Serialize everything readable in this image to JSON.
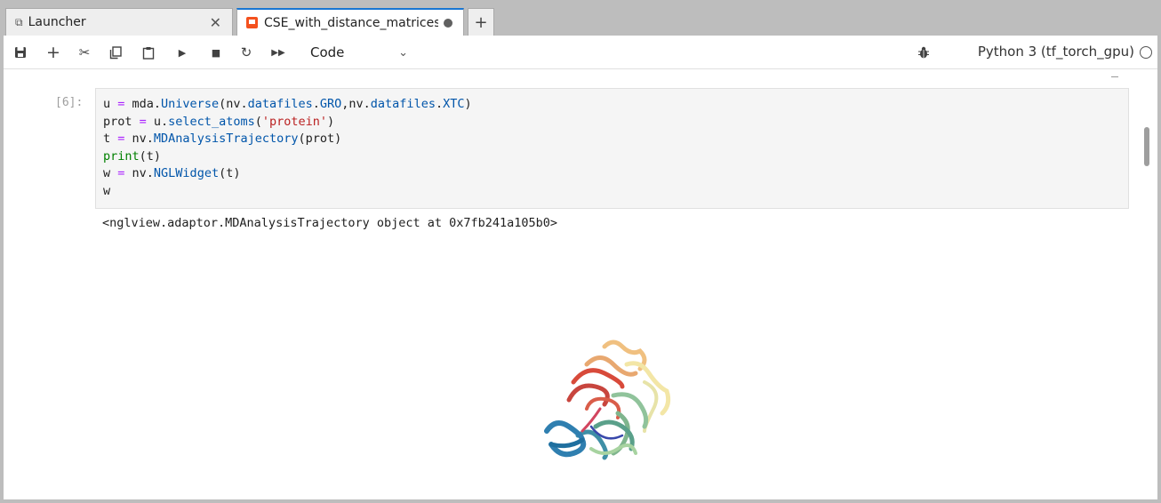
{
  "tabs": [
    {
      "label": "Launcher",
      "icon": "external-link-icon",
      "active": false
    },
    {
      "label": "CSE_with_distance_matrices",
      "icon": "notebook-icon",
      "active": true,
      "unsaved": true
    }
  ],
  "toolbar": {
    "cell_type": "Code",
    "kernel_name": "Python 3 (tf_torch_gpu)",
    "buttons": [
      "save-icon",
      "add-cell-icon",
      "cut-icon",
      "copy-icon",
      "paste-icon",
      "run-icon",
      "stop-icon",
      "restart-icon",
      "fast-forward-icon"
    ]
  },
  "cell": {
    "prompt": "[6]:",
    "lines": [
      [
        {
          "t": "u "
        },
        {
          "t": "=",
          "c": "op"
        },
        {
          "t": " mda."
        },
        {
          "t": "Universe",
          "c": "attr"
        },
        {
          "t": "(nv."
        },
        {
          "t": "datafiles",
          "c": "attr"
        },
        {
          "t": "."
        },
        {
          "t": "GRO",
          "c": "attr"
        },
        {
          "t": ",nv."
        },
        {
          "t": "datafiles",
          "c": "attr"
        },
        {
          "t": "."
        },
        {
          "t": "XTC",
          "c": "attr"
        },
        {
          "t": ")"
        }
      ],
      [
        {
          "t": "prot "
        },
        {
          "t": "=",
          "c": "op"
        },
        {
          "t": " u."
        },
        {
          "t": "select_atoms",
          "c": "attr"
        },
        {
          "t": "("
        },
        {
          "t": "'protein'",
          "c": "str"
        },
        {
          "t": ")"
        }
      ],
      [
        {
          "t": "t "
        },
        {
          "t": "=",
          "c": "op"
        },
        {
          "t": " nv."
        },
        {
          "t": "MDAnalysisTrajectory",
          "c": "attr"
        },
        {
          "t": "(prot)"
        }
      ],
      [
        {
          "t": "print",
          "c": "builtin"
        },
        {
          "t": "(t)"
        }
      ],
      [
        {
          "t": "w "
        },
        {
          "t": "=",
          "c": "op"
        },
        {
          "t": " nv."
        },
        {
          "t": "NGLWidget",
          "c": "attr"
        },
        {
          "t": "(t)"
        }
      ],
      [
        {
          "t": "w"
        }
      ]
    ],
    "output": "<nglview.adaptor.MDAnalysisTrajectory object at 0x7fb241a105b0>"
  },
  "colors": {
    "accent": "#1976d2",
    "notebook_icon": "#f4511e",
    "keyword_op": "#aa22ff",
    "attribute": "#0055aa",
    "string": "#ba2121",
    "builtin": "#008000"
  },
  "widget": {
    "description_icon": "protein-structure-icon"
  }
}
